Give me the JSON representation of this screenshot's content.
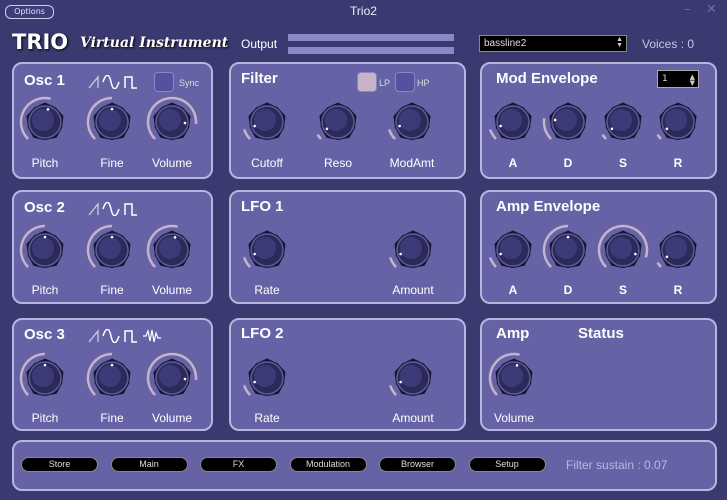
{
  "window": {
    "title": "Trio2",
    "options_label": "Options",
    "minimize": "–",
    "close": "✕"
  },
  "header": {
    "logo": "TRIO",
    "subtitle": "Virtual Instrument",
    "output_label": "Output",
    "preset": "bassline2",
    "voices": "Voices : 0"
  },
  "osc1": {
    "title": "Osc 1",
    "sync_label": "Sync",
    "waves": [
      "saw-icon",
      "sine-icon",
      "square-icon"
    ],
    "knobs": [
      {
        "label": "Pitch",
        "value": 0.55
      },
      {
        "label": "Fine",
        "value": 0.5
      },
      {
        "label": "Volume",
        "value": 0.85
      }
    ]
  },
  "osc2": {
    "title": "Osc 2",
    "waves": [
      "saw-icon",
      "sine-icon",
      "square-icon"
    ],
    "knobs": [
      {
        "label": "Pitch",
        "value": 0.5
      },
      {
        "label": "Fine",
        "value": 0.5
      },
      {
        "label": "Volume",
        "value": 0.55
      }
    ]
  },
  "osc3": {
    "title": "Osc 3",
    "waves": [
      "saw-icon",
      "sine-icon",
      "square-icon",
      "noise-icon"
    ],
    "knobs": [
      {
        "label": "Pitch",
        "value": 0.5
      },
      {
        "label": "Fine",
        "value": 0.5
      },
      {
        "label": "Volume",
        "value": 0.85
      }
    ]
  },
  "filter": {
    "title": "Filter",
    "lp_label": "LP",
    "hp_label": "HP",
    "lp_on": true,
    "hp_on": false,
    "knobs": [
      {
        "label": "Cutoff",
        "value": 0.1
      },
      {
        "label": "Reso",
        "value": 0.05
      },
      {
        "label": "ModAmt",
        "value": 0.1
      }
    ]
  },
  "lfo1": {
    "title": "LFO 1",
    "knobs": [
      {
        "label": "Rate",
        "value": 0.1
      },
      {
        "label": "Amount",
        "value": 0.1
      }
    ]
  },
  "lfo2": {
    "title": "LFO 2",
    "knobs": [
      {
        "label": "Rate",
        "value": 0.1
      },
      {
        "label": "Amount",
        "value": 0.1
      }
    ]
  },
  "mod_env": {
    "title": "Mod Envelope",
    "selector": "1",
    "knobs": [
      {
        "label": "A",
        "value": 0.1
      },
      {
        "label": "D",
        "value": 0.2
      },
      {
        "label": "S",
        "value": 0.05
      },
      {
        "label": "R",
        "value": 0.05
      }
    ]
  },
  "amp_env": {
    "title": "Amp Envelope",
    "knobs": [
      {
        "label": "A",
        "value": 0.1
      },
      {
        "label": "D",
        "value": 0.5
      },
      {
        "label": "S",
        "value": 0.9
      },
      {
        "label": "R",
        "value": 0.05
      }
    ]
  },
  "amp": {
    "title": "Amp",
    "status_title": "Status",
    "knobs": [
      {
        "label": "Volume",
        "value": 0.55
      }
    ]
  },
  "footer": {
    "buttons": [
      "Store",
      "Main",
      "FX",
      "Modulation",
      "Browser",
      "Setup"
    ],
    "status": "Filter sustain : 0.07"
  },
  "colors": {
    "background": "#3a3970",
    "panel": "#6662a6",
    "panel_border": "#b8b6dc",
    "lp_active": "#c9b3c8"
  }
}
